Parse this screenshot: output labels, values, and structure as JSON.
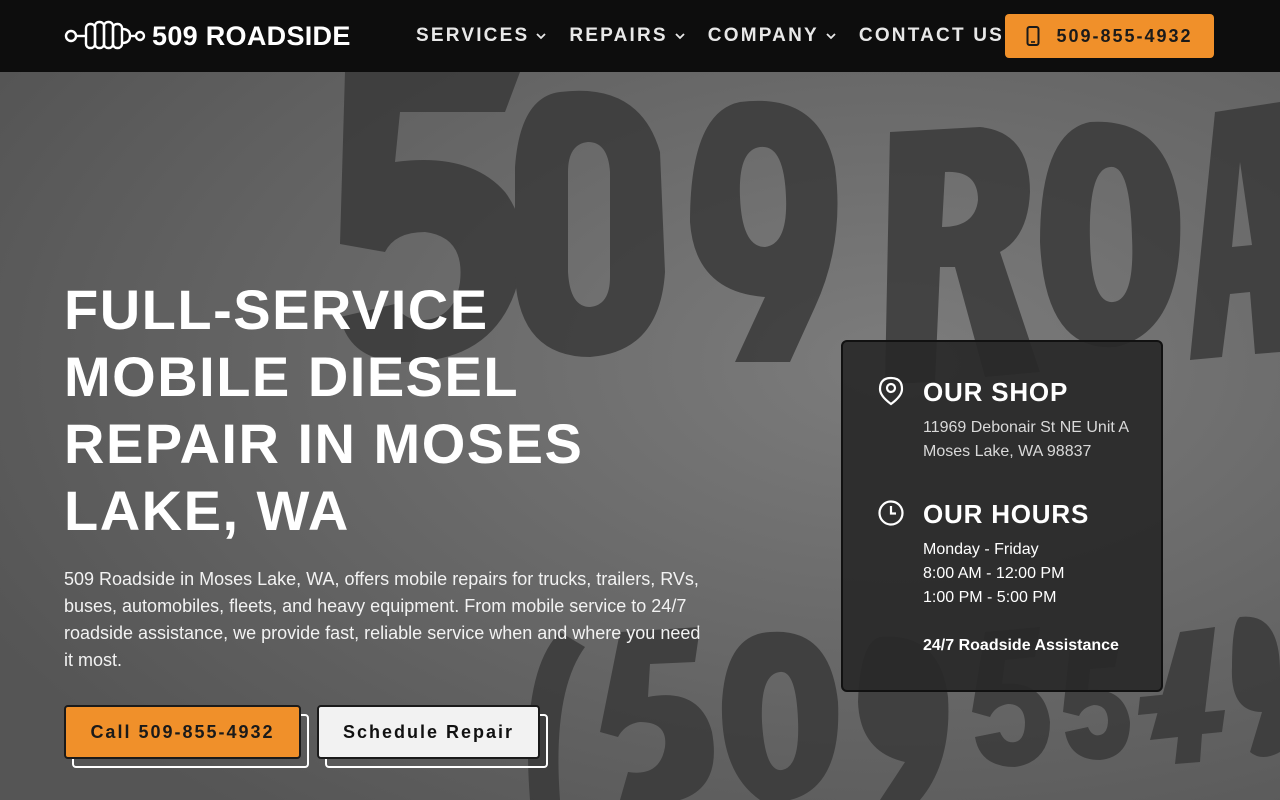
{
  "header": {
    "logo_text": "509 ROADSIDE",
    "nav": [
      {
        "label": "SERVICES",
        "has_dropdown": true
      },
      {
        "label": "REPAIRS",
        "has_dropdown": true
      },
      {
        "label": "COMPANY",
        "has_dropdown": true
      },
      {
        "label": "CONTACT US",
        "has_dropdown": false
      }
    ],
    "phone_button": "509-855-4932",
    "phone_icon": "mobile-phone-icon"
  },
  "hero": {
    "headline": "FULL-SERVICE MOBILE DIESEL REPAIR IN MOSES LAKE, WA",
    "description": "509 Roadside in Moses Lake, WA, offers mobile repairs for trucks, trailers, RVs, buses, automobiles, fleets, and heavy equipment. From mobile service to 24/7 roadside assistance, we provide fast, reliable service when and where you need it most.",
    "call_button": "Call 509-855-4932",
    "schedule_button": "Schedule Repair"
  },
  "info_card": {
    "shop": {
      "icon": "map-pin-icon",
      "heading": "OUR SHOP",
      "address_line1": "11969 Debonair St NE Unit A",
      "address_line2": "Moses Lake, WA 98837"
    },
    "hours": {
      "icon": "clock-icon",
      "heading": "OUR HOURS",
      "days": "Monday - Friday",
      "morning": "8:00 AM - 12:00 PM",
      "afternoon": "1:00 PM - 5:00 PM",
      "roadside": "24/7 Roadside Assistance"
    }
  },
  "colors": {
    "accent": "#f0902a",
    "header_bg": "#0d0d0d",
    "card_bg": "#282828"
  }
}
